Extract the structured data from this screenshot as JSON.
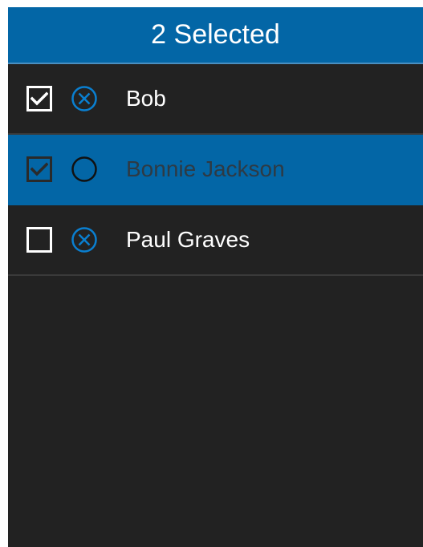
{
  "header": {
    "title": "2 Selected"
  },
  "colors": {
    "accent": "#0366a6",
    "background": "#222222",
    "text": "#ffffff",
    "selected_text": "#2e3a44"
  },
  "rows": [
    {
      "name": "Bob",
      "checked": true,
      "status_icon": "circle-x-icon",
      "selected": false
    },
    {
      "name": "Bonnie Jackson",
      "checked": true,
      "status_icon": "circle-icon",
      "selected": true
    },
    {
      "name": "Paul Graves",
      "checked": false,
      "status_icon": "circle-x-icon",
      "selected": false
    }
  ]
}
